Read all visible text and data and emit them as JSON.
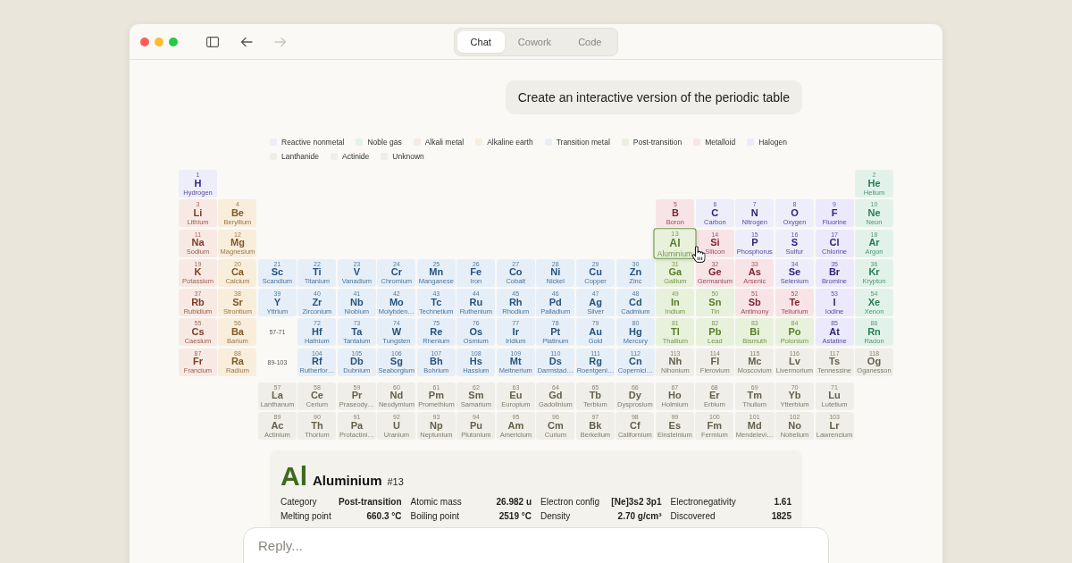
{
  "nav": {
    "back": {
      "disabled": false
    },
    "forward": {
      "disabled": true
    }
  },
  "tabs": [
    {
      "label": "Chat",
      "selected": true
    },
    {
      "label": "Cowork",
      "selected": false
    },
    {
      "label": "Code",
      "selected": false
    }
  ],
  "prompt": "Create an interactive version of the periodic table",
  "legend": [
    {
      "label": "Reactive nonmetal",
      "color": "#eeedfa"
    },
    {
      "label": "Noble gas",
      "color": "#e2f2ea"
    },
    {
      "label": "Alkali metal",
      "color": "#f8e9e4"
    },
    {
      "label": "Alkaline earth",
      "color": "#f9eddc"
    },
    {
      "label": "Transition metal",
      "color": "#e6eff8"
    },
    {
      "label": "Post-transition",
      "color": "#e8f1dc"
    },
    {
      "label": "Metalloid",
      "color": "#f8e4e7"
    },
    {
      "label": "Halogen",
      "color": "#ebe9fb"
    },
    {
      "label": "Lanthanide",
      "color": "#efeee9"
    },
    {
      "label": "Actinide",
      "color": "#efeee9"
    },
    {
      "label": "Unknown",
      "color": "#efeee9"
    }
  ],
  "table": {
    "rows": [
      {
        "left": [
          {
            "number": "1",
            "symbol": "H",
            "name": "Hydrogen",
            "color": "#eeedfa",
            "selected": false
          }
        ],
        "right": [
          {
            "number": "2",
            "symbol": "He",
            "name": "Helium",
            "color": "#e2f2ea",
            "selected": false
          }
        ]
      },
      {
        "left": [
          {
            "number": "3",
            "symbol": "Li",
            "name": "Lithium",
            "color": "#f8e9e4",
            "selected": false
          },
          {
            "number": "4",
            "symbol": "Be",
            "name": "Beryllium",
            "color": "#f9eddc",
            "selected": false
          }
        ],
        "right": [
          {
            "number": "5",
            "symbol": "B",
            "name": "Boron",
            "color": "#f8e4e7",
            "selected": false
          },
          {
            "number": "6",
            "symbol": "C",
            "name": "Carbon",
            "color": "#eeedfa",
            "selected": false
          },
          {
            "number": "7",
            "symbol": "N",
            "name": "Nitrogen",
            "color": "#eeedfa",
            "selected": false
          },
          {
            "number": "8",
            "symbol": "O",
            "name": "Oxygen",
            "color": "#eeedfa",
            "selected": false
          },
          {
            "number": "9",
            "symbol": "F",
            "name": "Fluorine",
            "color": "#ebe9fb",
            "selected": false
          },
          {
            "number": "10",
            "symbol": "Ne",
            "name": "Neon",
            "color": "#e2f2ea",
            "selected": false
          }
        ]
      },
      {
        "left": [
          {
            "number": "11",
            "symbol": "Na",
            "name": "Sodium",
            "color": "#f8e9e4",
            "selected": false
          },
          {
            "number": "12",
            "symbol": "Mg",
            "name": "Magnesium",
            "color": "#f9eddc",
            "selected": false
          }
        ],
        "right": [
          {
            "number": "13",
            "symbol": "Al",
            "name": "Aluminium",
            "color": "#e8f1dc",
            "selected": true
          },
          {
            "number": "14",
            "symbol": "Si",
            "name": "Silicon",
            "color": "#f8e4e7",
            "selected": false
          },
          {
            "number": "15",
            "symbol": "P",
            "name": "Phosphorus",
            "color": "#eeedfa",
            "selected": false
          },
          {
            "number": "16",
            "symbol": "S",
            "name": "Sulfur",
            "color": "#eeedfa",
            "selected": false
          },
          {
            "number": "17",
            "symbol": "Cl",
            "name": "Chlorine",
            "color": "#ebe9fb",
            "selected": false
          },
          {
            "number": "18",
            "symbol": "Ar",
            "name": "Argon",
            "color": "#e2f2ea",
            "selected": false
          }
        ]
      },
      {
        "left": [
          {
            "number": "19",
            "symbol": "K",
            "name": "Potassium",
            "color": "#f8e9e4",
            "selected": false
          },
          {
            "number": "20",
            "symbol": "Ca",
            "name": "Calcium",
            "color": "#f9eddc",
            "selected": false
          },
          {
            "number": "21",
            "symbol": "Sc",
            "name": "Scandium",
            "color": "#e6eff8",
            "selected": false
          },
          {
            "number": "22",
            "symbol": "Ti",
            "name": "Titanium",
            "color": "#e6eff8",
            "selected": false
          },
          {
            "number": "23",
            "symbol": "V",
            "name": "Vanadium",
            "color": "#e6eff8",
            "selected": false
          },
          {
            "number": "24",
            "symbol": "Cr",
            "name": "Chromium",
            "color": "#e6eff8",
            "selected": false
          },
          {
            "number": "25",
            "symbol": "Mn",
            "name": "Manganese",
            "color": "#e6eff8",
            "selected": false
          },
          {
            "number": "26",
            "symbol": "Fe",
            "name": "Iron",
            "color": "#e6eff8",
            "selected": false
          },
          {
            "number": "27",
            "symbol": "Co",
            "name": "Cobalt",
            "color": "#e6eff8",
            "selected": false
          },
          {
            "number": "28",
            "symbol": "Ni",
            "name": "Nickel",
            "color": "#e6eff8",
            "selected": false
          },
          {
            "number": "29",
            "symbol": "Cu",
            "name": "Copper",
            "color": "#e6eff8",
            "selected": false
          },
          {
            "number": "30",
            "symbol": "Zn",
            "name": "Zinc",
            "color": "#e6eff8",
            "selected": false
          },
          {
            "number": "31",
            "symbol": "Ga",
            "name": "Gallium",
            "color": "#e8f1dc",
            "selected": false
          },
          {
            "number": "32",
            "symbol": "Ge",
            "name": "Germanium",
            "color": "#f8e4e7",
            "selected": false
          },
          {
            "number": "33",
            "symbol": "As",
            "name": "Arsenic",
            "color": "#f8e4e7",
            "selected": false
          },
          {
            "number": "34",
            "symbol": "Se",
            "name": "Selenium",
            "color": "#eeedfa",
            "selected": false
          },
          {
            "number": "35",
            "symbol": "Br",
            "name": "Bromine",
            "color": "#ebe9fb",
            "selected": false
          },
          {
            "number": "36",
            "symbol": "Kr",
            "name": "Krypton",
            "color": "#e2f2ea",
            "selected": false
          }
        ],
        "right": []
      },
      {
        "left": [
          {
            "number": "37",
            "symbol": "Rb",
            "name": "Rubidium",
            "color": "#f8e9e4",
            "selected": false
          },
          {
            "number": "38",
            "symbol": "Sr",
            "name": "Strontium",
            "color": "#f9eddc",
            "selected": false
          },
          {
            "number": "39",
            "symbol": "Y",
            "name": "Yttrium",
            "color": "#e6eff8",
            "selected": false
          },
          {
            "number": "40",
            "symbol": "Zr",
            "name": "Zirconium",
            "color": "#e6eff8",
            "selected": false
          },
          {
            "number": "41",
            "symbol": "Nb",
            "name": "Niobium",
            "color": "#e6eff8",
            "selected": false
          },
          {
            "number": "42",
            "symbol": "Mo",
            "name": "Molybden…",
            "color": "#e6eff8",
            "selected": false
          },
          {
            "number": "43",
            "symbol": "Tc",
            "name": "Technetium",
            "color": "#e6eff8",
            "selected": false
          },
          {
            "number": "44",
            "symbol": "Ru",
            "name": "Ruthenium",
            "color": "#e6eff8",
            "selected": false
          },
          {
            "number": "45",
            "symbol": "Rh",
            "name": "Rhodium",
            "color": "#e6eff8",
            "selected": false
          },
          {
            "number": "46",
            "symbol": "Pd",
            "name": "Palladium",
            "color": "#e6eff8",
            "selected": false
          },
          {
            "number": "47",
            "symbol": "Ag",
            "name": "Silver",
            "color": "#e6eff8",
            "selected": false
          },
          {
            "number": "48",
            "symbol": "Cd",
            "name": "Cadmium",
            "color": "#e6eff8",
            "selected": false
          },
          {
            "number": "49",
            "symbol": "In",
            "name": "Indium",
            "color": "#e8f1dc",
            "selected": false
          },
          {
            "number": "50",
            "symbol": "Sn",
            "name": "Tin",
            "color": "#e8f1dc",
            "selected": false
          },
          {
            "number": "51",
            "symbol": "Sb",
            "name": "Antimony",
            "color": "#f8e4e7",
            "selected": false
          },
          {
            "number": "52",
            "symbol": "Te",
            "name": "Tellurium",
            "color": "#f8e4e7",
            "selected": false
          },
          {
            "number": "53",
            "symbol": "I",
            "name": "Iodine",
            "color": "#ebe9fb",
            "selected": false
          },
          {
            "number": "54",
            "symbol": "Xe",
            "name": "Xenon",
            "color": "#e2f2ea",
            "selected": false
          }
        ],
        "right": []
      },
      {
        "left": [
          {
            "number": "55",
            "symbol": "Cs",
            "name": "Caesium",
            "color": "#f8e9e4",
            "selected": false
          },
          {
            "number": "56",
            "symbol": "Ba",
            "name": "Barium",
            "color": "#f9eddc",
            "selected": false
          }
        ],
        "range": "57-71",
        "right": [
          {
            "number": "72",
            "symbol": "Hf",
            "name": "Hafnium",
            "color": "#e6eff8",
            "selected": false
          },
          {
            "number": "73",
            "symbol": "Ta",
            "name": "Tantalum",
            "color": "#e6eff8",
            "selected": false
          },
          {
            "number": "74",
            "symbol": "W",
            "name": "Tungsten",
            "color": "#e6eff8",
            "selected": false
          },
          {
            "number": "75",
            "symbol": "Re",
            "name": "Rhenium",
            "color": "#e6eff8",
            "selected": false
          },
          {
            "number": "76",
            "symbol": "Os",
            "name": "Osmium",
            "color": "#e6eff8",
            "selected": false
          },
          {
            "number": "77",
            "symbol": "Ir",
            "name": "Iridium",
            "color": "#e6eff8",
            "selected": false
          },
          {
            "number": "78",
            "symbol": "Pt",
            "name": "Platinum",
            "color": "#e6eff8",
            "selected": false
          },
          {
            "number": "79",
            "symbol": "Au",
            "name": "Gold",
            "color": "#e6eff8",
            "selected": false
          },
          {
            "number": "80",
            "symbol": "Hg",
            "name": "Mercury",
            "color": "#e6eff8",
            "selected": false
          },
          {
            "number": "81",
            "symbol": "Tl",
            "name": "Thallium",
            "color": "#e8f1dc",
            "selected": false
          },
          {
            "number": "82",
            "symbol": "Pb",
            "name": "Lead",
            "color": "#e8f1dc",
            "selected": false
          },
          {
            "number": "83",
            "symbol": "Bi",
            "name": "Bismuth",
            "color": "#e8f1dc",
            "selected": false
          },
          {
            "number": "84",
            "symbol": "Po",
            "name": "Polonium",
            "color": "#e8f1dc",
            "selected": false
          },
          {
            "number": "85",
            "symbol": "At",
            "name": "Astatine",
            "color": "#ebe9fb",
            "selected": false
          },
          {
            "number": "86",
            "symbol": "Rn",
            "name": "Radon",
            "color": "#e2f2ea",
            "selected": false
          }
        ]
      },
      {
        "left": [
          {
            "number": "87",
            "symbol": "Fr",
            "name": "Francium",
            "color": "#f8e9e4",
            "selected": false
          },
          {
            "number": "88",
            "symbol": "Ra",
            "name": "Radium",
            "color": "#f9eddc",
            "selected": false
          }
        ],
        "range": "89-103",
        "right": [
          {
            "number": "104",
            "symbol": "Rf",
            "name": "Rutherfor…",
            "color": "#e6eff8",
            "selected": false
          },
          {
            "number": "105",
            "symbol": "Db",
            "name": "Dubnium",
            "color": "#e6eff8",
            "selected": false
          },
          {
            "number": "106",
            "symbol": "Sg",
            "name": "Seaborgium",
            "color": "#e6eff8",
            "selected": false
          },
          {
            "number": "107",
            "symbol": "Bh",
            "name": "Bohrium",
            "color": "#e6eff8",
            "selected": false
          },
          {
            "number": "108",
            "symbol": "Hs",
            "name": "Hassium",
            "color": "#e6eff8",
            "selected": false
          },
          {
            "number": "109",
            "symbol": "Mt",
            "name": "Meitnerium",
            "color": "#e6eff8",
            "selected": false
          },
          {
            "number": "110",
            "symbol": "Ds",
            "name": "Darmstad…",
            "color": "#e6eff8",
            "selected": false
          },
          {
            "number": "111",
            "symbol": "Rg",
            "name": "Roentgeni…",
            "color": "#e6eff8",
            "selected": false
          },
          {
            "number": "112",
            "symbol": "Cn",
            "name": "Copernici…",
            "color": "#e6eff8",
            "selected": false
          },
          {
            "number": "113",
            "symbol": "Nh",
            "name": "Nihonium",
            "color": "#efeee9",
            "selected": false
          },
          {
            "number": "114",
            "symbol": "Fl",
            "name": "Flerovium",
            "color": "#efeee9",
            "selected": false
          },
          {
            "number": "115",
            "symbol": "Mc",
            "name": "Moscovium",
            "color": "#efeee9",
            "selected": false
          },
          {
            "number": "116",
            "symbol": "Lv",
            "name": "Livermorium",
            "color": "#efeee9",
            "selected": false
          },
          {
            "number": "117",
            "symbol": "Ts",
            "name": "Tennessine",
            "color": "#efeee9",
            "selected": false
          },
          {
            "number": "118",
            "symbol": "Og",
            "name": "Oganesson",
            "color": "#efeee9",
            "selected": false
          }
        ]
      }
    ],
    "f_block": [
      [
        {
          "number": "57",
          "symbol": "La",
          "name": "Lanthanum",
          "color": "#efeee9",
          "selected": false
        },
        {
          "number": "58",
          "symbol": "Ce",
          "name": "Cerium",
          "color": "#efeee9",
          "selected": false
        },
        {
          "number": "59",
          "symbol": "Pr",
          "name": "Praseody…",
          "color": "#efeee9",
          "selected": false
        },
        {
          "number": "60",
          "symbol": "Nd",
          "name": "Neodymium",
          "color": "#efeee9",
          "selected": false
        },
        {
          "number": "61",
          "symbol": "Pm",
          "name": "Promethium",
          "color": "#efeee9",
          "selected": false
        },
        {
          "number": "62",
          "symbol": "Sm",
          "name": "Samarium",
          "color": "#efeee9",
          "selected": false
        },
        {
          "number": "63",
          "symbol": "Eu",
          "name": "Europium",
          "color": "#efeee9",
          "selected": false
        },
        {
          "number": "64",
          "symbol": "Gd",
          "name": "Gadolinium",
          "color": "#efeee9",
          "selected": false
        },
        {
          "number": "65",
          "symbol": "Tb",
          "name": "Terbium",
          "color": "#efeee9",
          "selected": false
        },
        {
          "number": "66",
          "symbol": "Dy",
          "name": "Dysprosium",
          "color": "#efeee9",
          "selected": false
        },
        {
          "number": "67",
          "symbol": "Ho",
          "name": "Holmium",
          "color": "#efeee9",
          "selected": false
        },
        {
          "number": "68",
          "symbol": "Er",
          "name": "Erbium",
          "color": "#efeee9",
          "selected": false
        },
        {
          "number": "69",
          "symbol": "Tm",
          "name": "Thulium",
          "color": "#efeee9",
          "selected": false
        },
        {
          "number": "70",
          "symbol": "Yb",
          "name": "Ytterbium",
          "color": "#efeee9",
          "selected": false
        },
        {
          "number": "71",
          "symbol": "Lu",
          "name": "Lutetium",
          "color": "#efeee9",
          "selected": false
        }
      ],
      [
        {
          "number": "89",
          "symbol": "Ac",
          "name": "Actinium",
          "color": "#efeee9",
          "selected": false
        },
        {
          "number": "90",
          "symbol": "Th",
          "name": "Thorium",
          "color": "#efeee9",
          "selected": false
        },
        {
          "number": "91",
          "symbol": "Pa",
          "name": "Protactini…",
          "color": "#efeee9",
          "selected": false
        },
        {
          "number": "92",
          "symbol": "U",
          "name": "Uranium",
          "color": "#efeee9",
          "selected": false
        },
        {
          "number": "93",
          "symbol": "Np",
          "name": "Neptunium",
          "color": "#efeee9",
          "selected": false
        },
        {
          "number": "94",
          "symbol": "Pu",
          "name": "Plutonium",
          "color": "#efeee9",
          "selected": false
        },
        {
          "number": "95",
          "symbol": "Am",
          "name": "Americium",
          "color": "#efeee9",
          "selected": false
        },
        {
          "number": "96",
          "symbol": "Cm",
          "name": "Curium",
          "color": "#efeee9",
          "selected": false
        },
        {
          "number": "97",
          "symbol": "Bk",
          "name": "Berkelium",
          "color": "#efeee9",
          "selected": false
        },
        {
          "number": "98",
          "symbol": "Cf",
          "name": "Californium",
          "color": "#efeee9",
          "selected": false
        },
        {
          "number": "99",
          "symbol": "Es",
          "name": "Einsteinium",
          "color": "#efeee9",
          "selected": false
        },
        {
          "number": "100",
          "symbol": "Fm",
          "name": "Fermium",
          "color": "#efeee9",
          "selected": false
        },
        {
          "number": "101",
          "symbol": "Md",
          "name": "Mendelevi…",
          "color": "#efeee9",
          "selected": false
        },
        {
          "number": "102",
          "symbol": "No",
          "name": "Nobelium",
          "color": "#efeee9",
          "selected": false
        },
        {
          "number": "103",
          "symbol": "Lr",
          "name": "Lawrencium",
          "color": "#efeee9",
          "selected": false
        }
      ]
    ]
  },
  "details": {
    "symbol": "Al",
    "name": "Aluminium",
    "number": "#13",
    "color": "#3d6a1c",
    "properties": [
      {
        "label": "Category",
        "value": "Post-transition"
      },
      {
        "label": "Atomic mass",
        "value": "26.982 u"
      },
      {
        "label": "Electron config",
        "value": "[Ne]3s2 3p1"
      },
      {
        "label": "Electronegativity",
        "value": "1.61"
      },
      {
        "label": "Melting point",
        "value": "660.3 °C"
      },
      {
        "label": "Boiling point",
        "value": "2519 °C"
      },
      {
        "label": "Density",
        "value": "2.70 g/cm³"
      },
      {
        "label": "Discovered",
        "value": "1825"
      }
    ]
  },
  "reply": {
    "placeholder": "Reply..."
  }
}
